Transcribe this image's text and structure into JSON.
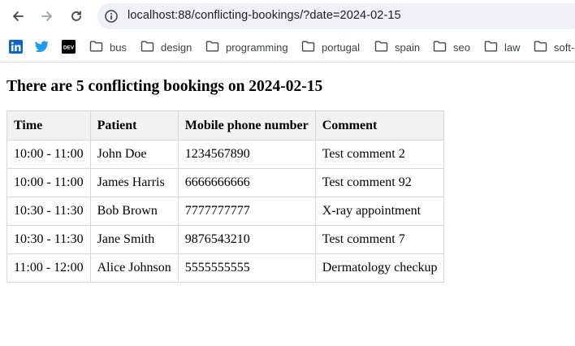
{
  "browser": {
    "url": "localhost:88/conflicting-bookings/?date=2024-02-15",
    "nav": {
      "back_icon": "arrow-back-icon",
      "forward_icon": "arrow-forward-icon",
      "reload_icon": "reload-icon",
      "site_info_icon": "site-info-icon"
    }
  },
  "bookmarks": {
    "icons": [
      "linkedin-icon",
      "twitter-icon",
      "dev-icon"
    ],
    "folders": [
      {
        "label": "bus"
      },
      {
        "label": "design"
      },
      {
        "label": "programming"
      },
      {
        "label": "portugal"
      },
      {
        "label": "spain"
      },
      {
        "label": "seo"
      },
      {
        "label": "law"
      },
      {
        "label": "soft-"
      }
    ]
  },
  "page": {
    "heading": "There are 5 conflicting bookings on 2024-02-15",
    "table": {
      "headers": [
        "Time",
        "Patient",
        "Mobile phone number",
        "Comment"
      ],
      "rows": [
        [
          "10:00 - 11:00",
          "John Doe",
          "1234567890",
          "Test comment 2"
        ],
        [
          "10:00 - 11:00",
          "James Harris",
          "6666666666",
          "Test comment 92"
        ],
        [
          "10:30 - 11:30",
          "Bob Brown",
          "7777777777",
          "X-ray appointment"
        ],
        [
          "10:30 - 11:30",
          "Jane Smith",
          "9876543210",
          "Test comment 7"
        ],
        [
          "11:00 - 12:00",
          "Alice Johnson",
          "5555555555",
          "Dermatology checkup"
        ]
      ]
    }
  },
  "colors": {
    "omnibox_bg": "#eef1f8",
    "linkedin": "#0a66c2",
    "twitter": "#1d9bf0",
    "table_header_bg": "#f2f2f2",
    "table_border": "#d6d6d6"
  }
}
